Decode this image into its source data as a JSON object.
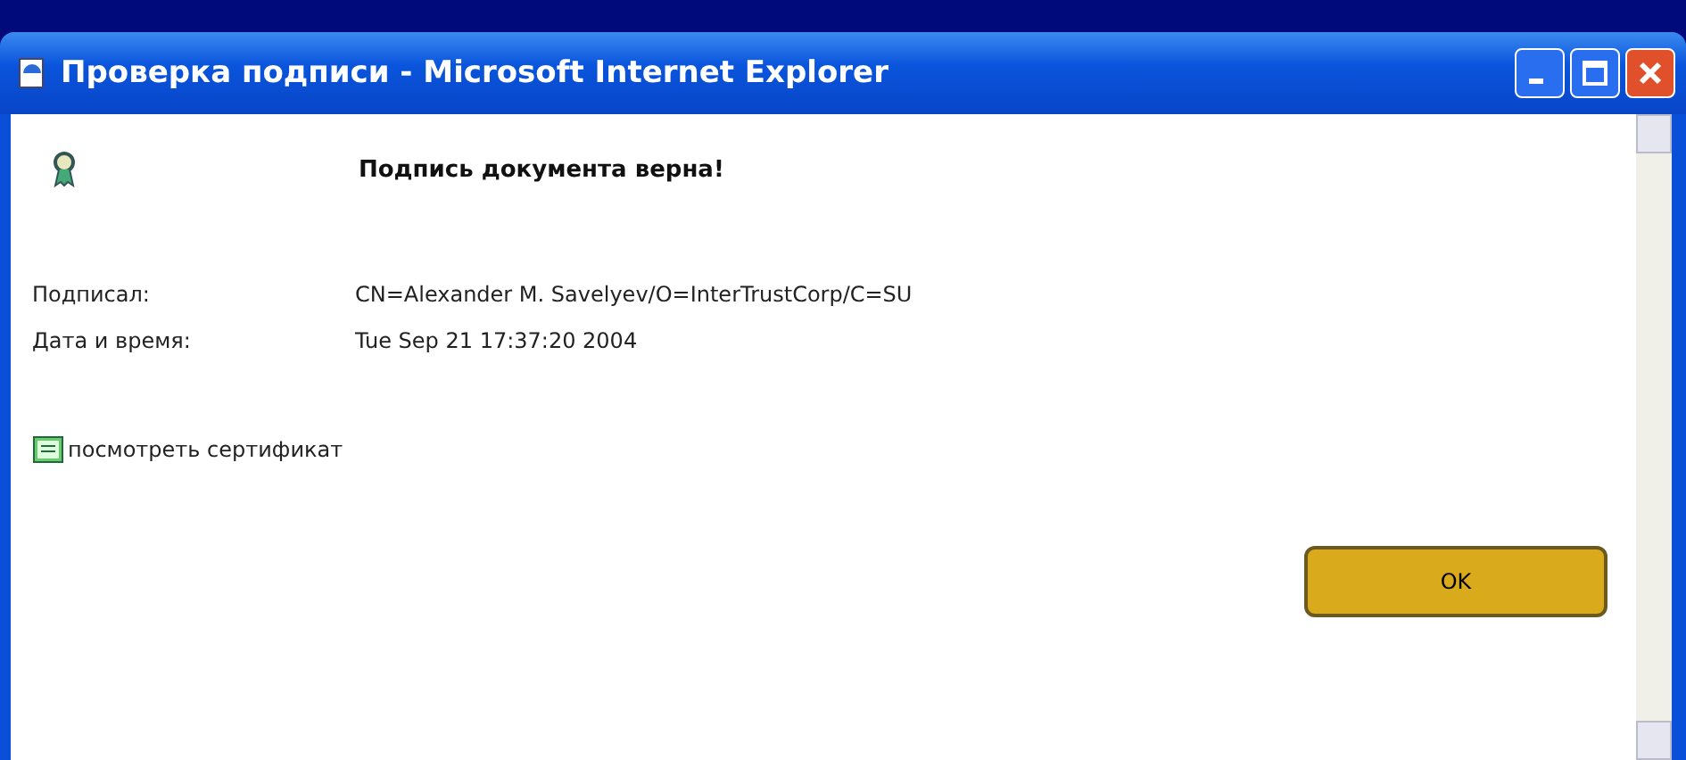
{
  "window": {
    "title": "Проверка подписи - Microsoft Internet Explorer"
  },
  "heading": "Подпись документа верна!",
  "fields": [
    {
      "label": "Подписал:",
      "value": "CN=Alexander M. Savelyev/O=InterTrustCorp/C=SU"
    },
    {
      "label": "Дата и время:",
      "value": "Tue Sep 21 17:37:20 2004"
    }
  ],
  "link": "посмотреть сертификат",
  "buttons": [
    "OK"
  ]
}
